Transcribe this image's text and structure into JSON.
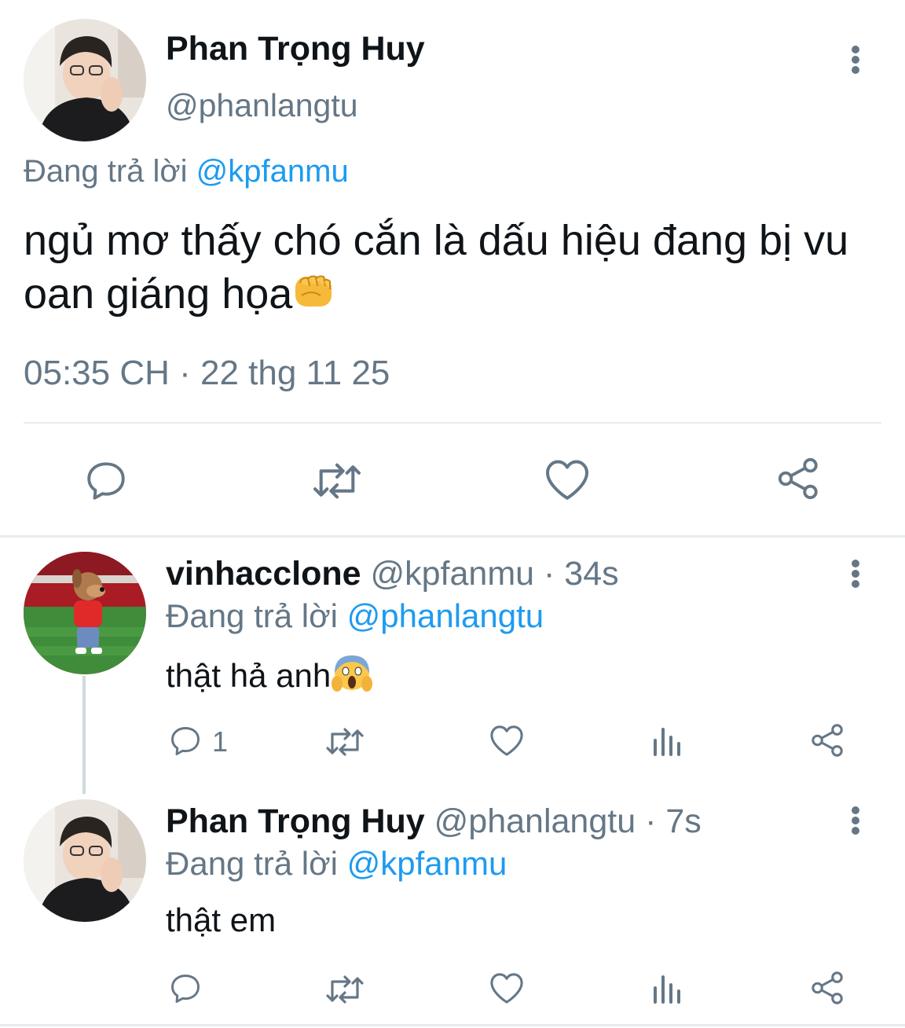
{
  "main_tweet": {
    "author_name": "Phan Trọng Huy",
    "author_handle": "@phanlangtu",
    "replying_prefix": "Đang trả lời",
    "replying_to": "@kpfanmu",
    "text": "ngủ mơ thấy chó cắn là dấu hiệu đang bị vu oan giáng họa",
    "emoji": "oncoming-fist",
    "timestamp": "05:35 CH · 22 thg 11 25",
    "actions": [
      "reply-icon",
      "retweet-icon",
      "like-icon",
      "share-icon"
    ]
  },
  "replies": [
    {
      "author_name": "vinhacclone",
      "author_handle": "@kpfanmu",
      "time_sep": "·",
      "time": "34s",
      "replying_prefix": "Đang trả lời",
      "replying_to": "@phanlangtu",
      "text": "thật hả anh",
      "emoji": "face-screaming-in-fear",
      "reply_count": "1"
    },
    {
      "author_name": "Phan Trọng Huy",
      "author_handle": "@phanlangtu",
      "time_sep": "·",
      "time": "7s",
      "replying_prefix": "Đang trả lời",
      "replying_to": "@kpfanmu",
      "text": "thật em"
    }
  ],
  "colors": {
    "link": "#1d9bf0",
    "muted": "#657786",
    "text": "#0f1419",
    "divider": "#e6ecf0"
  }
}
